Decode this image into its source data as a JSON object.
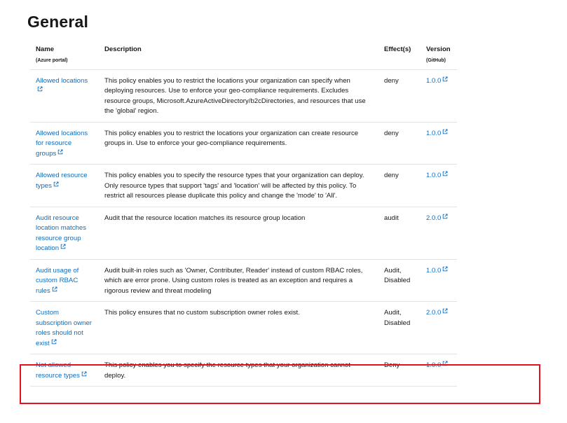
{
  "heading": "General",
  "columns": {
    "name": "Name",
    "name_sub": "(Azure portal)",
    "description": "Description",
    "effects": "Effect(s)",
    "version": "Version",
    "version_sub": "(GitHub)"
  },
  "rows": [
    {
      "name": "Allowed locations",
      "description": "This policy enables you to restrict the locations your organization can specify when deploying resources. Use to enforce your geo-compliance requirements. Excludes resource groups, Microsoft.AzureActiveDirectory/b2cDirectories, and resources that use the 'global' region.",
      "effects": "deny",
      "version": "1.0.0"
    },
    {
      "name": "Allowed locations for resource groups",
      "description": "This policy enables you to restrict the locations your organization can create resource groups in. Use to enforce your geo-compliance requirements.",
      "effects": "deny",
      "version": "1.0.0"
    },
    {
      "name": "Allowed resource types",
      "description": "This policy enables you to specify the resource types that your organization can deploy. Only resource types that support 'tags' and 'location' will be affected by this policy. To restrict all resources please duplicate this policy and change the 'mode' to 'All'.",
      "effects": "deny",
      "version": "1.0.0"
    },
    {
      "name": "Audit resource location matches resource group location",
      "description": "Audit that the resource location matches its resource group location",
      "effects": "audit",
      "version": "2.0.0"
    },
    {
      "name": "Audit usage of custom RBAC rules",
      "description": "Audit built-in roles such as 'Owner, Contributer, Reader' instead of custom RBAC roles, which are error prone. Using custom roles is treated as an exception and requires a rigorous review and threat modeling",
      "effects": "Audit, Disabled",
      "version": "1.0.0"
    },
    {
      "name": "Custom subscription owner roles should not exist",
      "description": "This policy ensures that no custom subscription owner roles exist.",
      "effects": "Audit, Disabled",
      "version": "2.0.0"
    },
    {
      "name": "Not allowed resource types",
      "description": "This policy enables you to specify the resource types that your organization cannot deploy.",
      "effects": "Deny",
      "version": "1.0.0"
    }
  ],
  "colors": {
    "link": "#0f6cbd",
    "highlight": "#e3101e",
    "divider": "#e3e3e3"
  },
  "icons": {
    "external_link": "external-link-icon"
  }
}
